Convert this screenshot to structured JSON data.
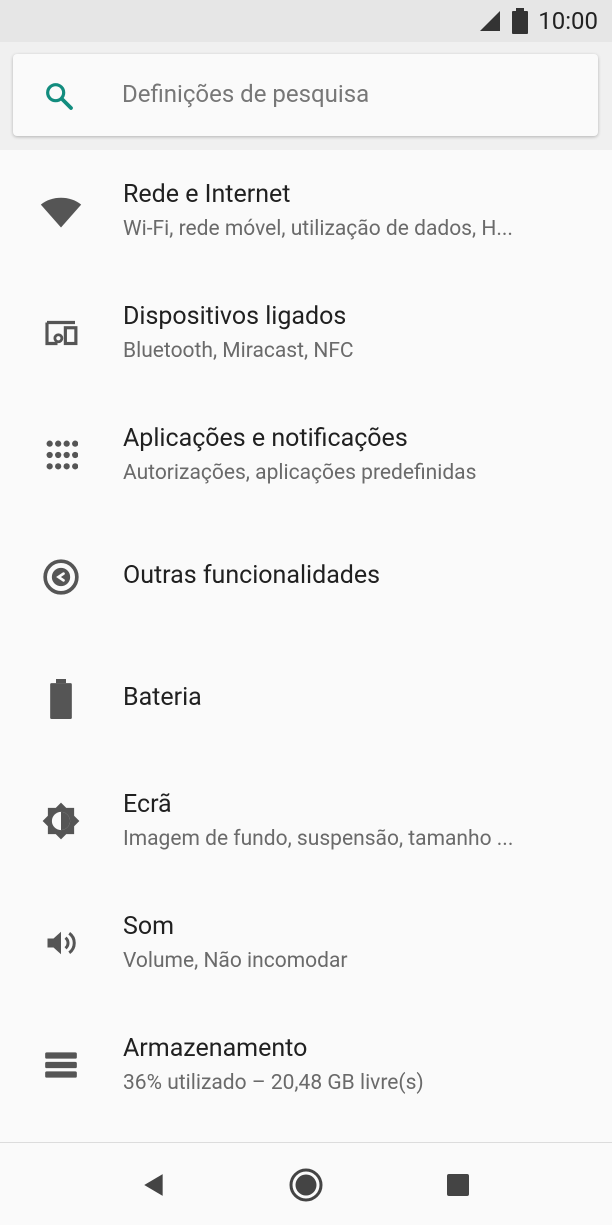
{
  "status_bar": {
    "time": "10:00",
    "icons": [
      "signal-icon",
      "battery-icon"
    ]
  },
  "search": {
    "placeholder": "Definições de pesquisa",
    "accent_color": "#128c7e"
  },
  "settings": {
    "items": [
      {
        "icon": "wifi-icon",
        "title": "Rede e Internet",
        "subtitle": "Wi-Fi, rede móvel, utilização de dados, H..."
      },
      {
        "icon": "connected-devices-icon",
        "title": "Dispositivos ligados",
        "subtitle": "Bluetooth, Miracast, NFC"
      },
      {
        "icon": "apps-grid-icon",
        "title": "Aplicações e notificações",
        "subtitle": "Autorizações, aplicações predefinidas"
      },
      {
        "icon": "more-features-icon",
        "title": "Outras funcionalidades",
        "subtitle": ""
      },
      {
        "icon": "battery-icon",
        "title": "Bateria",
        "subtitle": ""
      },
      {
        "icon": "brightness-icon",
        "title": "Ecrã",
        "subtitle": "Imagem de fundo, suspensão, tamanho ..."
      },
      {
        "icon": "volume-icon",
        "title": "Som",
        "subtitle": "Volume, Não incomodar"
      },
      {
        "icon": "storage-icon",
        "title": "Armazenamento",
        "subtitle": "36% utilizado – 20,48 GB livre(s)"
      }
    ]
  },
  "nav_bar": {
    "buttons": [
      "back-icon",
      "home-icon",
      "recents-icon"
    ]
  },
  "colors": {
    "icon": "#555555",
    "title": "#202020",
    "subtitle": "#6a6a6a",
    "background": "#fafafa"
  }
}
